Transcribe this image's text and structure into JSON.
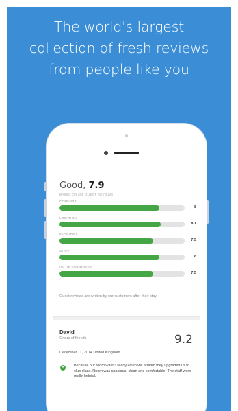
{
  "headline": {
    "line1": "The world's largest",
    "line2": "collection of fresh reviews",
    "line3": "from people like you"
  },
  "score": {
    "label": "Good,",
    "value": "7.9",
    "subtitle": "BASED ON 608 GUEST REVIEWS"
  },
  "metrics": [
    {
      "label": "COMFORT",
      "value": "8",
      "fraction": 0.8
    },
    {
      "label": "LOCATION",
      "value": "8.1",
      "fraction": 0.81
    },
    {
      "label": "FACILITIES",
      "value": "7.5",
      "fraction": 0.75
    },
    {
      "label": "STAFF",
      "value": "8",
      "fraction": 0.8
    },
    {
      "label": "VALUE FOR MONEY",
      "value": "7.5",
      "fraction": 0.75
    }
  ],
  "note": "Guest reviews are written by our customers after their stay.",
  "review": {
    "name": "David",
    "group": "Group of friends",
    "score": "9.2",
    "date": "December 11, 2014 United Kingdom",
    "text": "Because our room wasn't ready when we arrived they upgraded us to club class. Room was spacious, clean and comfortable. The staff were really helpful."
  },
  "colors": {
    "background": "#3b8ed6",
    "bar_fill": "#45a646",
    "bar_track": "#e3e3e3"
  },
  "icons": {
    "positive": "plus-icon"
  }
}
